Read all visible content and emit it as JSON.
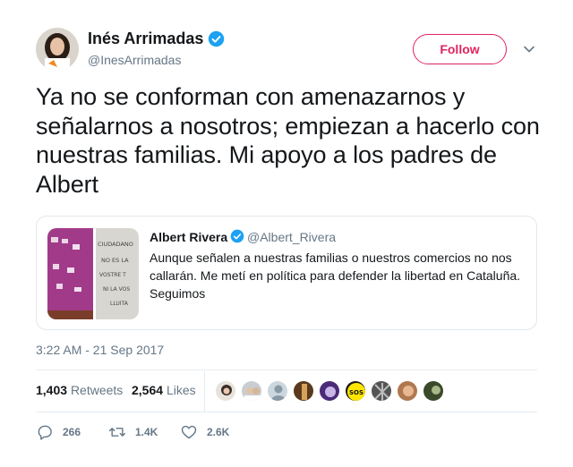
{
  "author": {
    "name": "Inés Arrimadas",
    "handle": "@InesArrimadas",
    "verified": true
  },
  "follow_label": "Follow",
  "tweet_text": "Ya no se conforman con amenazarnos y señalarnos a nosotros; empiezan a hacerlo con nuestras familias. Mi apoyo a los padres de Albert",
  "quoted": {
    "name": "Albert Rivera",
    "handle": "@Albert_Rivera",
    "verified": true,
    "text": "Aunque señalen a nuestras familias o nuestros comercios no nos callarán. Me metí en política para defender la libertad en Cataluña. Seguimos",
    "photo_text": [
      "CIUDADANO",
      "NO ES LA",
      "VOSTRE T",
      "NI LA VOS",
      "LLUITA"
    ]
  },
  "timestamp": "3:22 AM - 21 Sep 2017",
  "stats": {
    "retweets_count": "1,403",
    "retweets_label": "Retweets",
    "likes_count": "2,564",
    "likes_label": "Likes"
  },
  "likers_sos_text": "SOS",
  "actions": {
    "reply_count": "266",
    "retweet_count": "1.4K",
    "like_count": "2.6K"
  },
  "colors": {
    "accent": "#e0245e",
    "verified": "#1da1f2",
    "text": "#14171a",
    "muted": "#657786",
    "border": "#e1e8ed"
  }
}
